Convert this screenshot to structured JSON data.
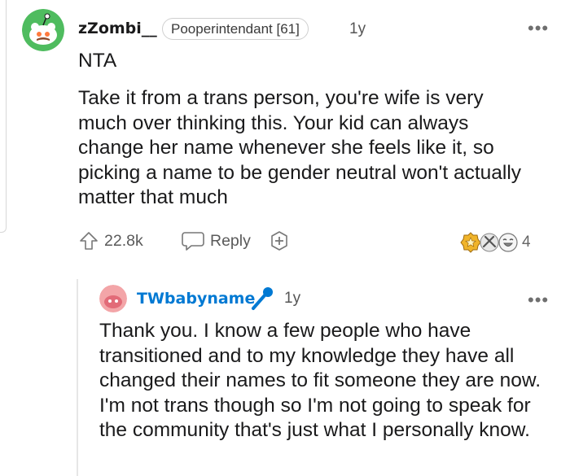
{
  "comment": {
    "username": "zZombi__",
    "flair": "Pooperintendant [61]",
    "age": "1y",
    "more": "•••",
    "verdict": "NTA",
    "body": "Take it from a trans person, you're wife is very much over thinking this. Your kid can always change her name whenever she feels like it, so picking a name to be gender neutral won't actually matter that much",
    "upvotes": "22.8k",
    "reply_label": "Reply",
    "award_count": "4"
  },
  "reply": {
    "username": "TWbabyname",
    "age": "1y",
    "more": "•••",
    "body": "Thank you. I know a few people who have transitioned and to my knowledge they have all changed their names to fit someone they are now. I'm not trans though so I'm not going to speak for the community that's just what I personally know."
  },
  "colors": {
    "op_username": "#0079d3",
    "avatar_green": "#4fbc5f",
    "avatar_pink": "#f3a5a8",
    "op_mic": "#0079d3"
  }
}
